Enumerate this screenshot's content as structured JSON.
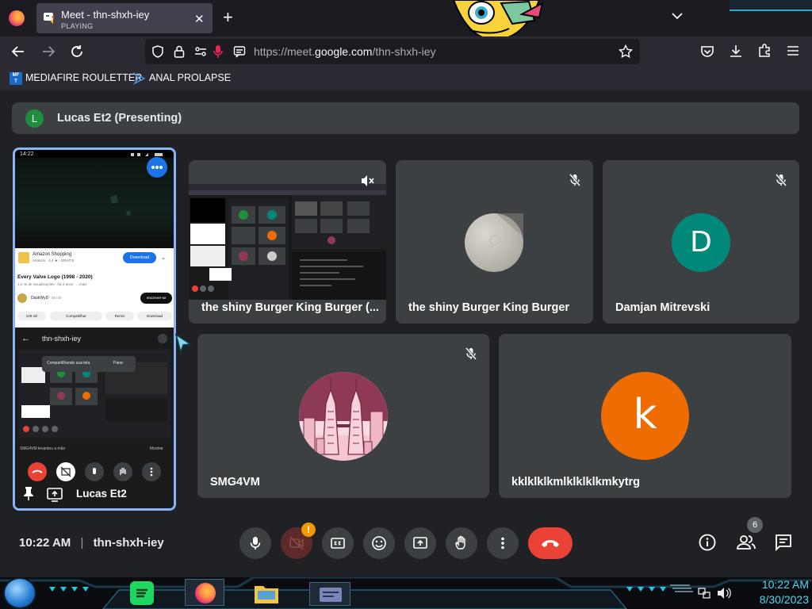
{
  "browser": {
    "tab": {
      "title": "Meet - thn-shxh-iey",
      "subtitle": "PLAYING"
    },
    "url": {
      "prefix": "https://meet.",
      "domain": "google.com",
      "path": "/thn-shxh-iey"
    },
    "bookmarks": [
      {
        "label": "MEDIAFIRE ROULETTER",
        "icon": "mediafire-icon"
      },
      {
        "label": "ANAL PROLAPSE",
        "icon": "bookmark-icon"
      }
    ]
  },
  "meet": {
    "presenting_banner": {
      "initial": "L",
      "text": "Lucas Et2 (Presenting)"
    },
    "share_tile": {
      "presenter_name": "Lucas Et2",
      "phone_time": "14:22",
      "app_name": "Amazon Shopping",
      "app_sub": "Anúncio · 4,4 ★ · GRÁTIS",
      "install_label": "Download",
      "video_title": "Every Valve Logo (1998 - 2020)",
      "video_meta": "1,2 mi de visualizações · há 3 anos · ...mais",
      "channel": "DaskWyD",
      "subs": "50 mil",
      "subscribe_label": "Inscrever-se",
      "actions": [
        "129 mil",
        "Compartilhar",
        "Remix",
        "Download"
      ],
      "meet_code": "thn-shxh-iey",
      "share_toast": "Compartilhando sua tela",
      "stop_label": "Parar",
      "raised_hand_text": "SMG4VM levantou a mão",
      "show_label": "Mostrar"
    },
    "tiles": [
      {
        "name": "the shiny Burger King Burger (...",
        "kind": "screen",
        "muted": "volume-off"
      },
      {
        "name": "the shiny Burger King Burger",
        "kind": "photo",
        "muted": "mic-off"
      },
      {
        "name": "Damjan Mitrevski",
        "kind": "initial",
        "initial": "D",
        "color": "#00897b",
        "muted": "mic-off"
      },
      {
        "name": "SMG4VM",
        "kind": "towers",
        "muted": "mic-off"
      },
      {
        "name": "kklklklkmlklklklkmkytrg",
        "kind": "initial",
        "initial": "k",
        "color": "#ef6c00"
      }
    ],
    "bottom_bar": {
      "time": "10:22 AM",
      "separator": "|",
      "meeting_code": "thn-shxh-iey",
      "people_count": "6",
      "camera_warning": "!"
    }
  },
  "taskbar": {
    "time": "10:22 AM",
    "date": "8/30/2023"
  },
  "colors": {
    "meet_bg": "#202124",
    "tile_bg": "#3c4043",
    "end_call": "#ea4335",
    "active_border": "#8ab4f8"
  }
}
